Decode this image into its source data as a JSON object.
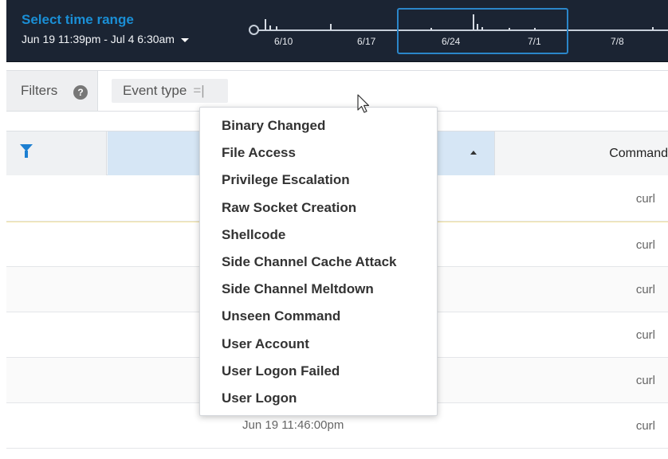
{
  "time_range": {
    "title": "Select time range",
    "range_label": "Jun 19 11:39pm - Jul 4 6:30am",
    "ticks": [
      "6/10",
      "6/17",
      "6/24",
      "7/1",
      "7/8"
    ]
  },
  "filters": {
    "label": "Filters",
    "help_symbol": "?",
    "chip": {
      "label": "Event type",
      "operator": "=",
      "cursor": "|"
    }
  },
  "table": {
    "columns": {
      "command": "Command"
    },
    "rows": [
      {
        "time": "",
        "command": "curl"
      },
      {
        "time": "",
        "command": "curl"
      },
      {
        "time": "",
        "command": "curl"
      },
      {
        "time": "",
        "command": "curl"
      },
      {
        "time": "",
        "command": "curl"
      },
      {
        "time": "Jun 19 11:46:00pm",
        "command": "curl"
      }
    ]
  },
  "dropdown": {
    "options": [
      "Binary Changed",
      "File Access",
      "Privilege Escalation",
      "Raw Socket Creation",
      "Shellcode",
      "Side Channel Cache Attack",
      "Side Channel Meltdown",
      "Unseen Command",
      "User Account",
      "User Logon Failed",
      "User Logon"
    ]
  },
  "colors": {
    "timebar_bg": "#1b2433",
    "accent": "#1a8fd6",
    "window_border": "#2b86c9",
    "sorted_header": "#d6e6f5"
  },
  "icons": [
    "chevron-down-icon",
    "help-icon",
    "funnel-icon",
    "sort-asc-icon",
    "mouse-pointer-icon",
    "range-handle-icon"
  ]
}
